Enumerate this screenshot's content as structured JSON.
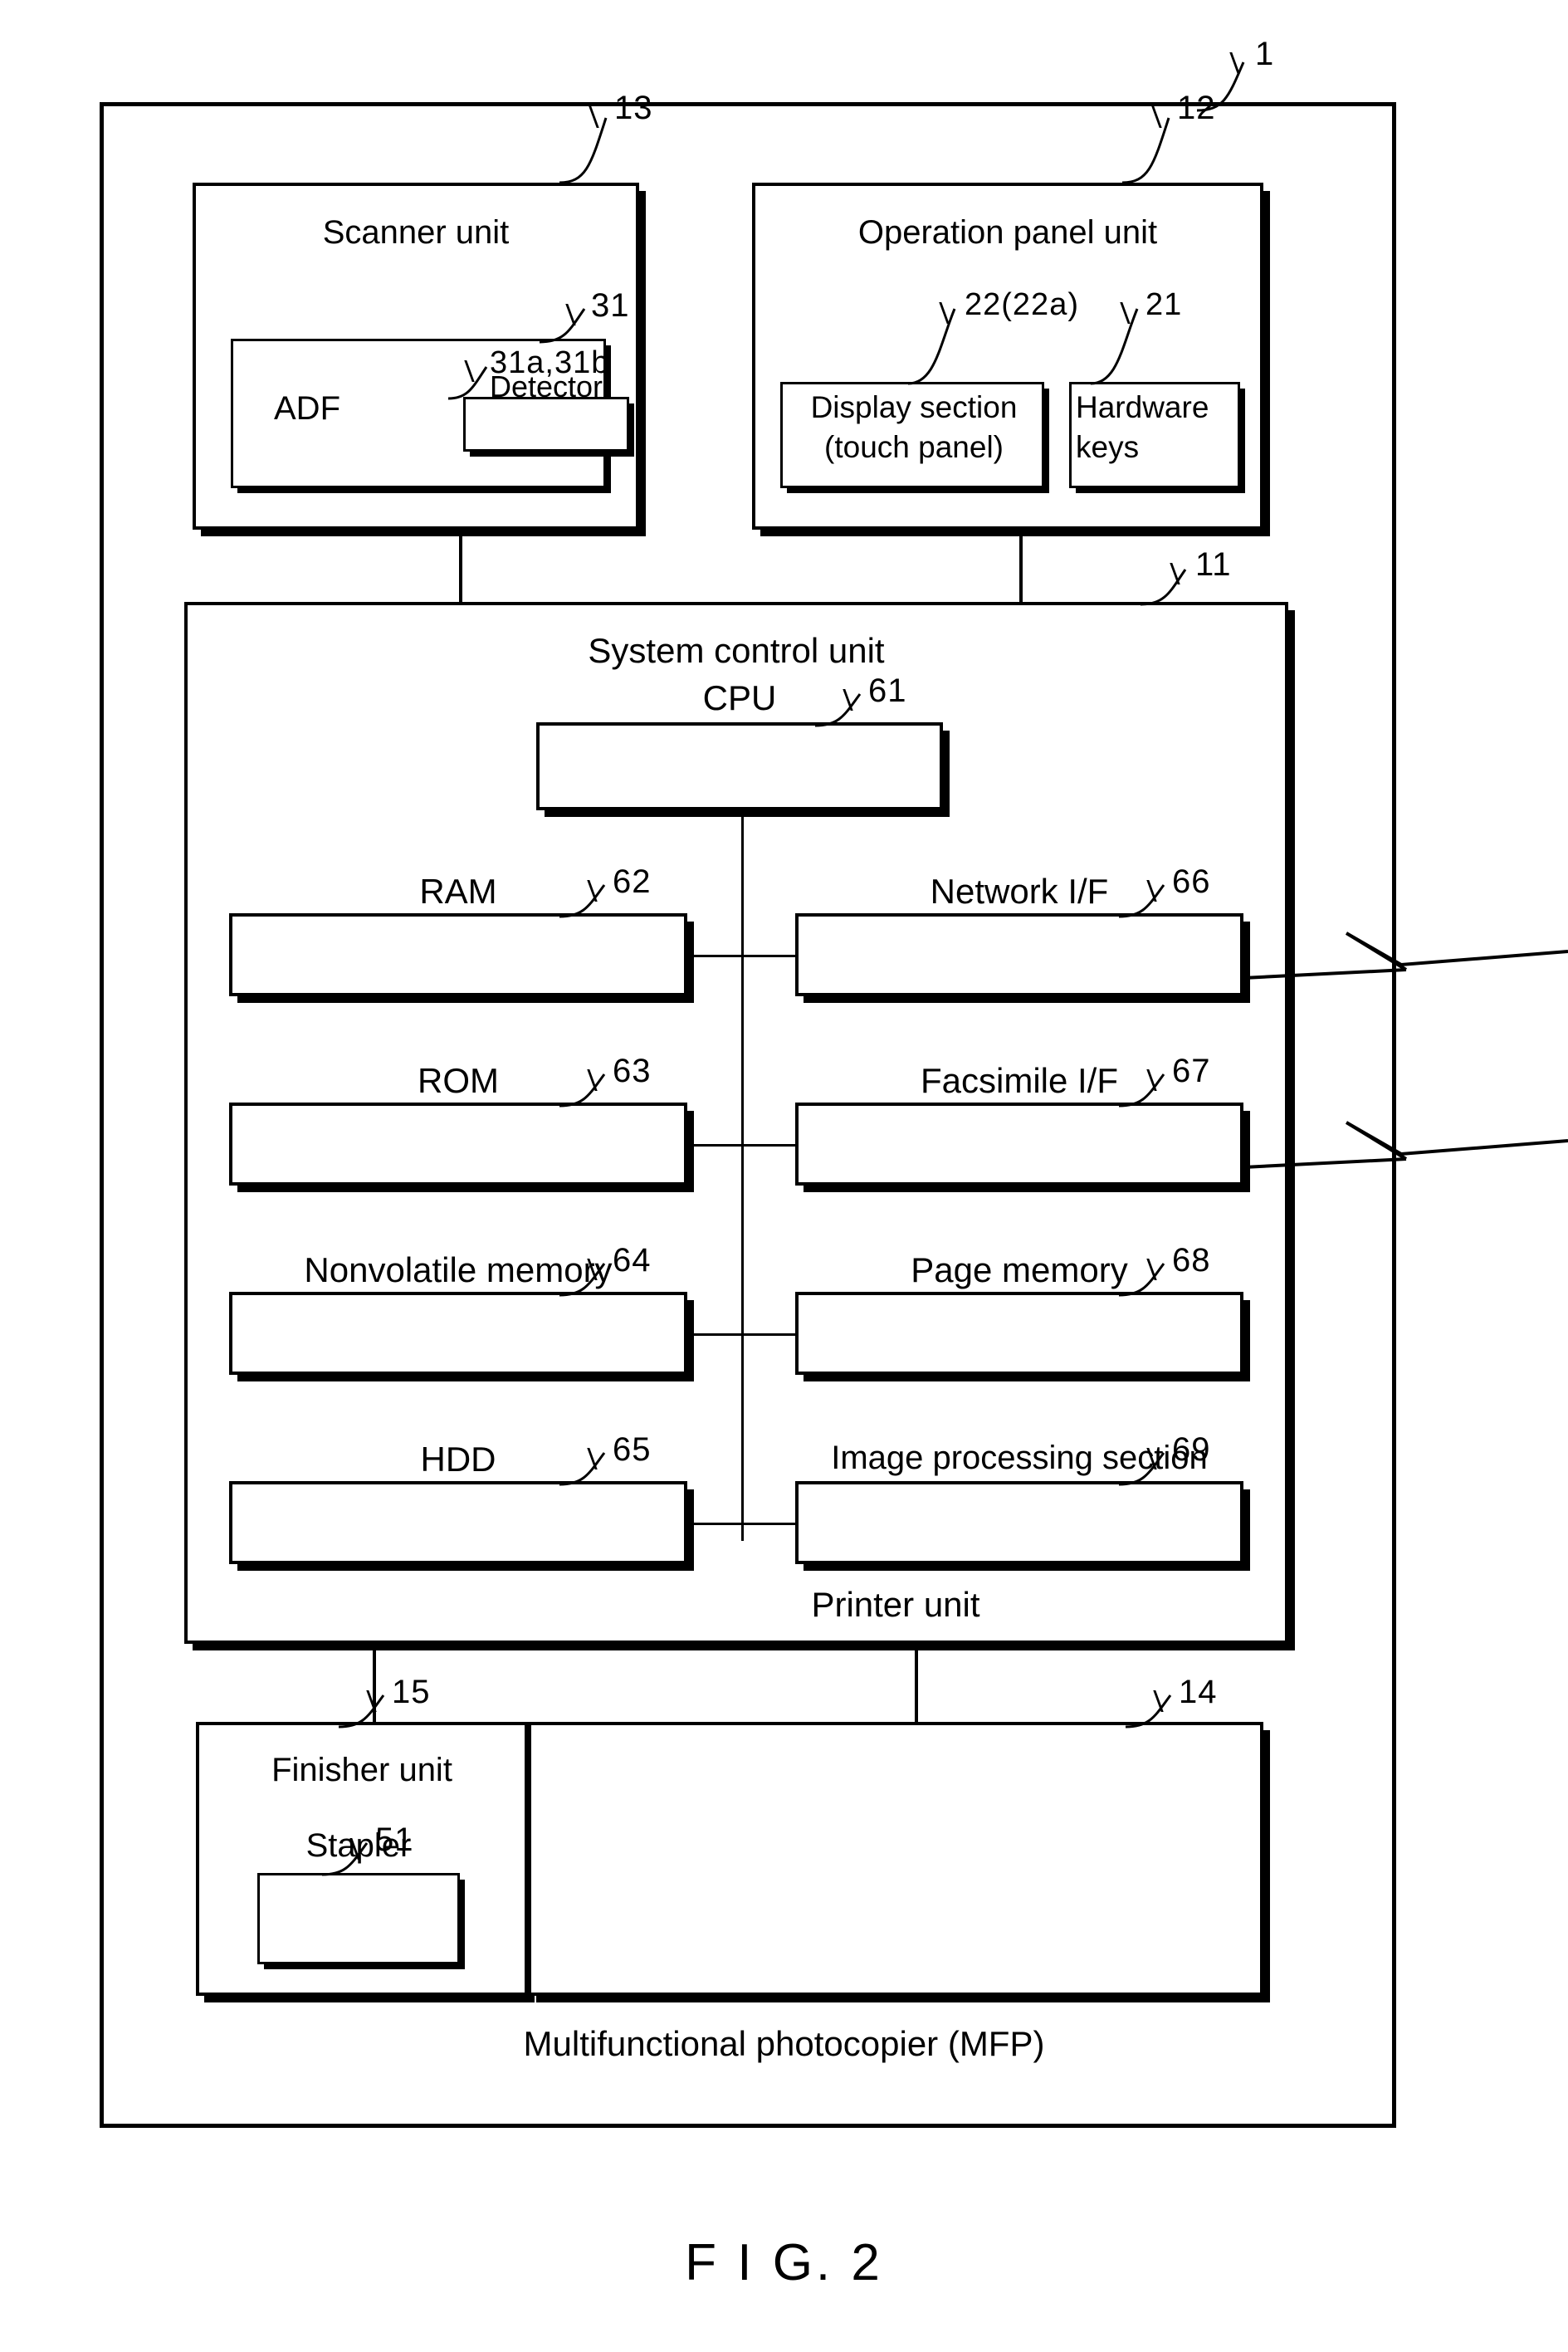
{
  "figure": {
    "caption": "F I G. 2",
    "outer_label": "1",
    "outer_title": "Multifunctional photocopier (MFP)"
  },
  "scanner_unit": {
    "label": "13",
    "title": "Scanner unit",
    "adf": {
      "label": "31",
      "title": "ADF",
      "detector": {
        "label": "31a,31b",
        "title": "Detector"
      }
    }
  },
  "operation_panel_unit": {
    "label": "12",
    "title": "Operation panel unit",
    "display_section": {
      "label": "22(22a)",
      "line1": "Display section",
      "line2": "(touch panel)"
    },
    "hardware_keys": {
      "label": "21",
      "line1": "Hardware",
      "line2": "keys"
    }
  },
  "system_control_unit": {
    "label": "11",
    "title": "System control unit",
    "cpu": {
      "label": "61",
      "title": "CPU"
    },
    "left_column": [
      {
        "label": "62",
        "title": "RAM"
      },
      {
        "label": "63",
        "title": "ROM"
      },
      {
        "label": "64",
        "title": "Nonvolatile memory"
      },
      {
        "label": "65",
        "title": "HDD"
      }
    ],
    "right_column": [
      {
        "label": "66",
        "title": "Network I/F"
      },
      {
        "label": "67",
        "title": "Facsimile I/F"
      },
      {
        "label": "68",
        "title": "Page memory"
      },
      {
        "label": "69",
        "title": "Image processing section"
      }
    ]
  },
  "finisher_unit": {
    "label": "15",
    "title": "Finisher unit",
    "stapler": {
      "label": "51",
      "title": "Stapler"
    }
  },
  "printer_unit": {
    "label": "14",
    "title": "Printer unit"
  }
}
